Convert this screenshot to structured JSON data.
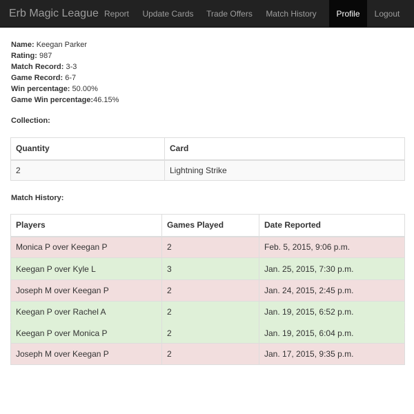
{
  "navbar": {
    "brand": "Erb Magic League",
    "items": [
      {
        "label": "Report",
        "active": false
      },
      {
        "label": "Update Cards",
        "active": false
      },
      {
        "label": "Trade Offers",
        "active": false
      },
      {
        "label": "Match History",
        "active": false
      },
      {
        "label": "Profile",
        "active": true
      },
      {
        "label": "Logout",
        "active": false
      }
    ]
  },
  "profile": {
    "name_label": "Name:",
    "name": "Keegan Parker",
    "rating_label": "Rating:",
    "rating": "987",
    "match_record_label": "Match Record:",
    "match_record": "3-3",
    "game_record_label": "Game Record:",
    "game_record": "6-7",
    "win_pct_label": "Win percentage:",
    "win_pct": "50.00%",
    "game_win_pct_label": "Game Win percentage:",
    "game_win_pct": "46.15%"
  },
  "collection": {
    "label": "Collection:",
    "headers": [
      "Quantity",
      "Card"
    ],
    "rows": [
      {
        "quantity": "2",
        "card": "Lightning Strike"
      }
    ]
  },
  "match_history": {
    "label": "Match History:",
    "headers": [
      "Players",
      "Games Played",
      "Date Reported"
    ],
    "rows": [
      {
        "players": "Monica P over Keegan P",
        "games": "2",
        "date": "Feb. 5, 2015, 9:06 p.m.",
        "result": "loss"
      },
      {
        "players": "Keegan P over Kyle L",
        "games": "3",
        "date": "Jan. 25, 2015, 7:30 p.m.",
        "result": "win"
      },
      {
        "players": "Joseph M over Keegan P",
        "games": "2",
        "date": "Jan. 24, 2015, 2:45 p.m.",
        "result": "loss"
      },
      {
        "players": "Keegan P over Rachel A",
        "games": "2",
        "date": "Jan. 19, 2015, 6:52 p.m.",
        "result": "win"
      },
      {
        "players": "Keegan P over Monica P",
        "games": "2",
        "date": "Jan. 19, 2015, 6:04 p.m.",
        "result": "win"
      },
      {
        "players": "Joseph M over Keegan P",
        "games": "2",
        "date": "Jan. 17, 2015, 9:35 p.m.",
        "result": "loss"
      }
    ]
  },
  "colors": {
    "navbar_bg": "#222222",
    "nav_active_bg": "#080808",
    "loss_row": "#f2dede",
    "win_row": "#dff0d8"
  }
}
